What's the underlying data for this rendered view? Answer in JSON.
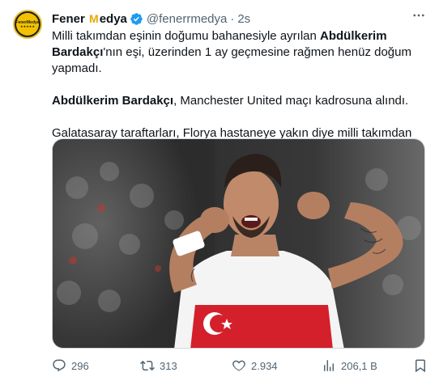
{
  "author": {
    "name_prefix": "Fener",
    "name_mid": "M",
    "name_suffix": "edya",
    "handle": "@fenerrmedya",
    "separator": "·",
    "time": "2s",
    "avatar_text": "FenerMedya",
    "avatar_stars": "★★★★★"
  },
  "tweet": {
    "line1a": "Milli takımdan eşinin doğumu bahanesiyle ayrılan ",
    "line1b": "Abdülkerim Bardakçı",
    "line1c": "'nın eşi, üzerinden 1 ay geçmesine rağmen henüz doğum yapmadı.",
    "line2a": "Abdülkerim Bardakçı",
    "line2b": ", Manchester United maçı kadrosuna alındı.",
    "line3": "Galatasaray taraftarları, Florya hastaneye yakın diye milli takımdan döndü demişti.."
  },
  "actions": {
    "replies": "296",
    "retweets": "313",
    "likes": "2.934",
    "views": "206,1 B"
  },
  "colors": {
    "text": "#0f1419",
    "secondary": "#536471",
    "verified": "#1d9bf0",
    "jersey_red": "#d3202b"
  },
  "icons": [
    "more-icon",
    "verified-badge-icon",
    "reply-icon",
    "retweet-icon",
    "like-icon",
    "views-icon",
    "bookmark-icon"
  ]
}
